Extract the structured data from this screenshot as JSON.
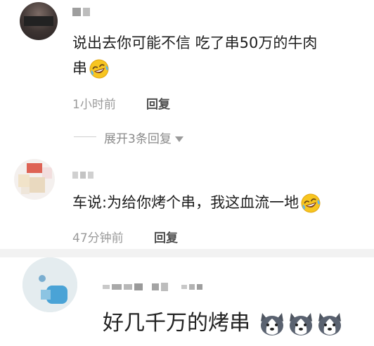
{
  "comments": [
    {
      "text": "说出去你可能不信 吃了串50万的牛肉",
      "text_line2": "串",
      "trailing_emoji": "laughing-crying-emoji",
      "time": "1小时前",
      "reply_label": "回复",
      "expand_label": "展开3条回复"
    },
    {
      "text": "车说:为给你烤个串，我这血流一地",
      "trailing_emoji": "laughing-crying-emoji",
      "time": "47分钟前",
      "reply_label": "回复"
    },
    {
      "text": "好几千万的烤串",
      "trailing_emoji": "husky-dog-emoji",
      "trailing_emoji_count": 3
    }
  ],
  "colors": {
    "text": "#1e1e1e",
    "meta": "#9a9a9a",
    "reply": "#4e4e4e",
    "emoji_yellow": "#f7c520"
  }
}
